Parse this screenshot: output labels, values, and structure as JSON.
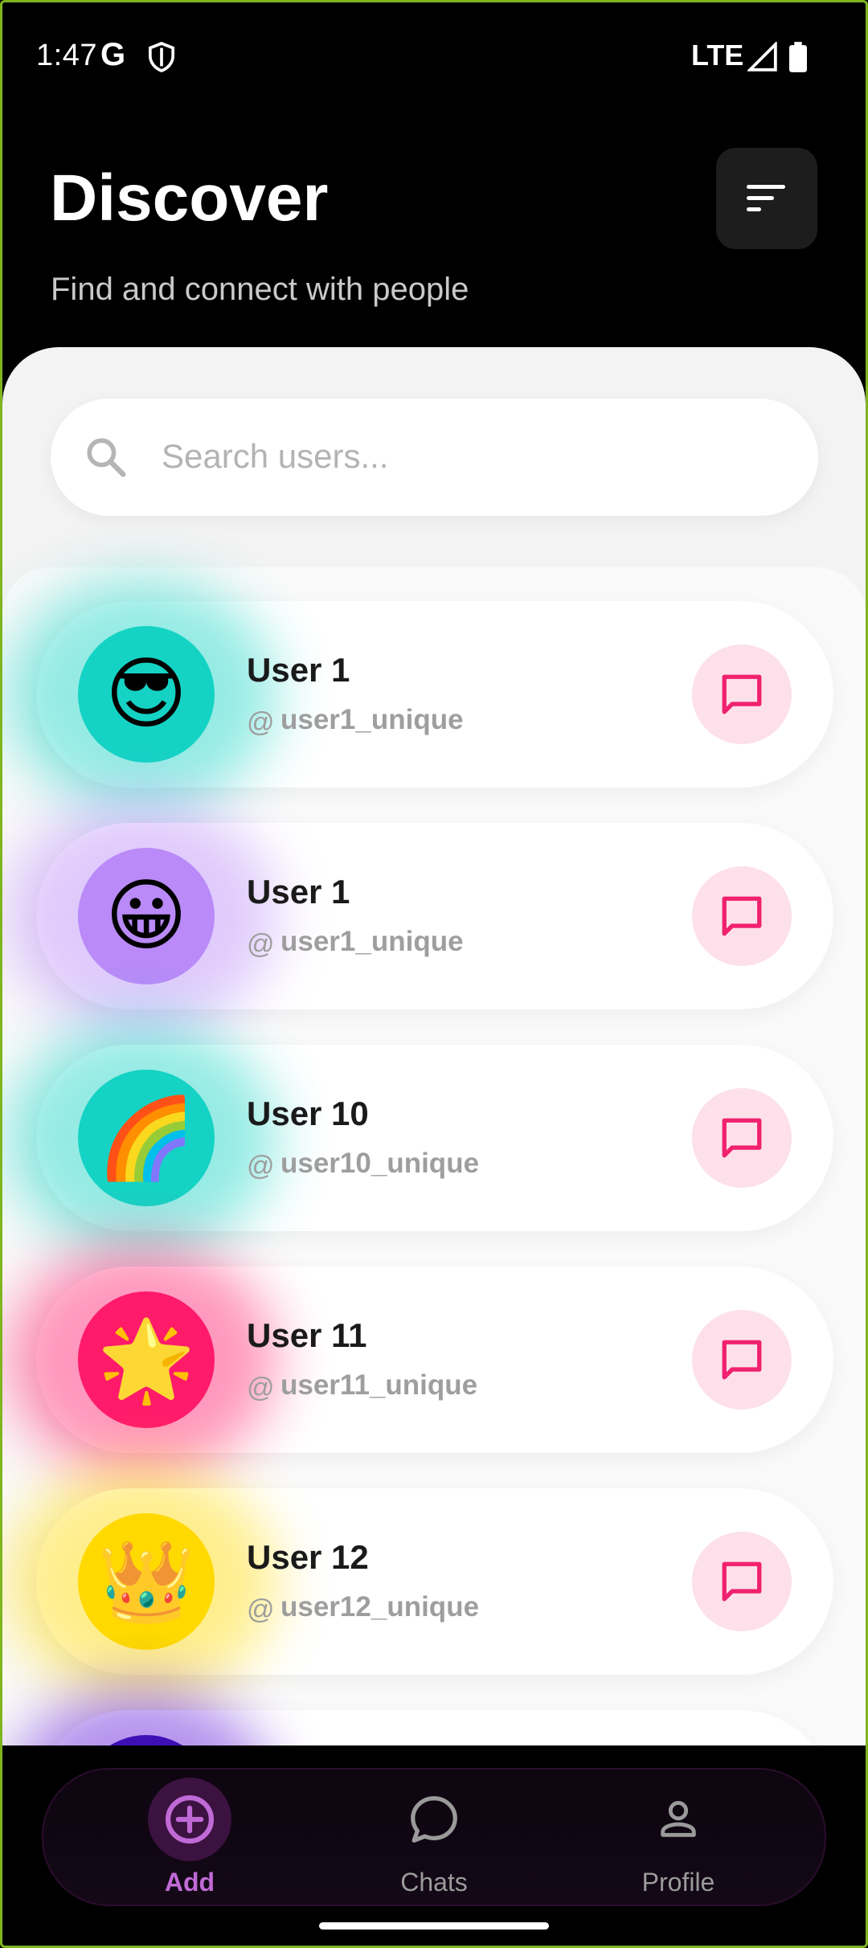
{
  "status_bar": {
    "time": "1:47",
    "google_badge": "G",
    "network": "LTE"
  },
  "header": {
    "title": "Discover",
    "subtitle": "Find and connect with people"
  },
  "search": {
    "placeholder": "Search users..."
  },
  "users": [
    {
      "name": "User 1",
      "at": "@",
      "handle": "user1_unique",
      "emoji": "😎",
      "color": "#14d3c4"
    },
    {
      "name": "User 1",
      "at": "@",
      "handle": "user1_unique",
      "emoji": "😀",
      "color": "#b98af8"
    },
    {
      "name": "User 10",
      "at": "@",
      "handle": "user10_unique",
      "emoji": "🌈",
      "color": "#14d3c4"
    },
    {
      "name": "User 11",
      "at": "@",
      "handle": "user11_unique",
      "emoji": "🌟",
      "color": "#ff1a6a"
    },
    {
      "name": "User 12",
      "at": "@",
      "handle": "user12_unique",
      "emoji": "👑",
      "color": "#ffd900"
    }
  ],
  "bottom_nav": {
    "items": [
      {
        "label": "Add",
        "icon": "add-circle-icon",
        "active": true
      },
      {
        "label": "Chats",
        "icon": "chat-bubble-icon",
        "active": false
      },
      {
        "label": "Profile",
        "icon": "person-icon",
        "active": false
      }
    ],
    "accent": "#c06ad6"
  },
  "colors": {
    "message_button_bg": "#fde0ea",
    "message_icon": "#f0216e",
    "background": "#000000"
  }
}
